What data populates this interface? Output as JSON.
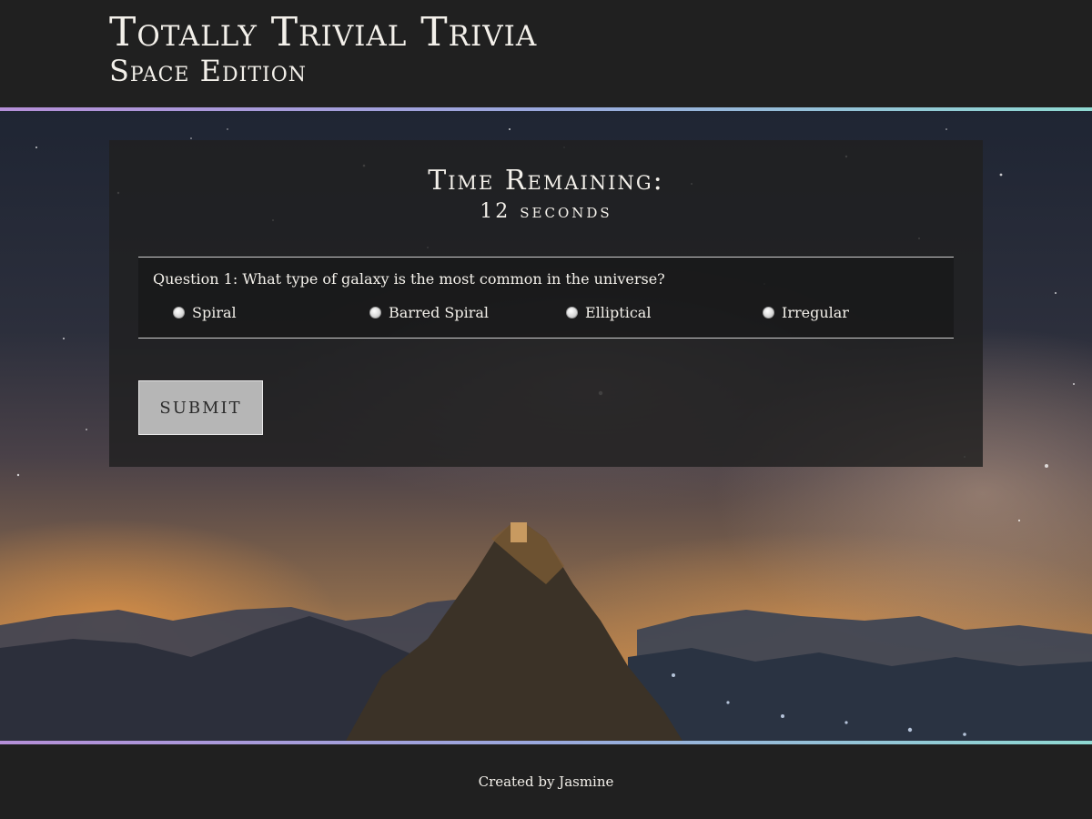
{
  "header": {
    "title": "Totally Trivial Trivia",
    "subtitle": "Space Edition"
  },
  "timer": {
    "label": "Time Remaining:",
    "value": "12 seconds"
  },
  "question": {
    "text": "Question 1:  What type of galaxy is the most common in the universe?",
    "options": [
      {
        "label": "Spiral"
      },
      {
        "label": "Barred Spiral"
      },
      {
        "label": "Elliptical"
      },
      {
        "label": "Irregular"
      }
    ]
  },
  "submit": {
    "label": "SUBMIT"
  },
  "footer": {
    "text": "Created by Jasmine"
  },
  "colors": {
    "background": "#202020",
    "text": "#f3f0ea",
    "accent_gradient_start": "#b58fd8",
    "accent_gradient_end": "#8fd9d2",
    "button": "#b6b6b6"
  }
}
